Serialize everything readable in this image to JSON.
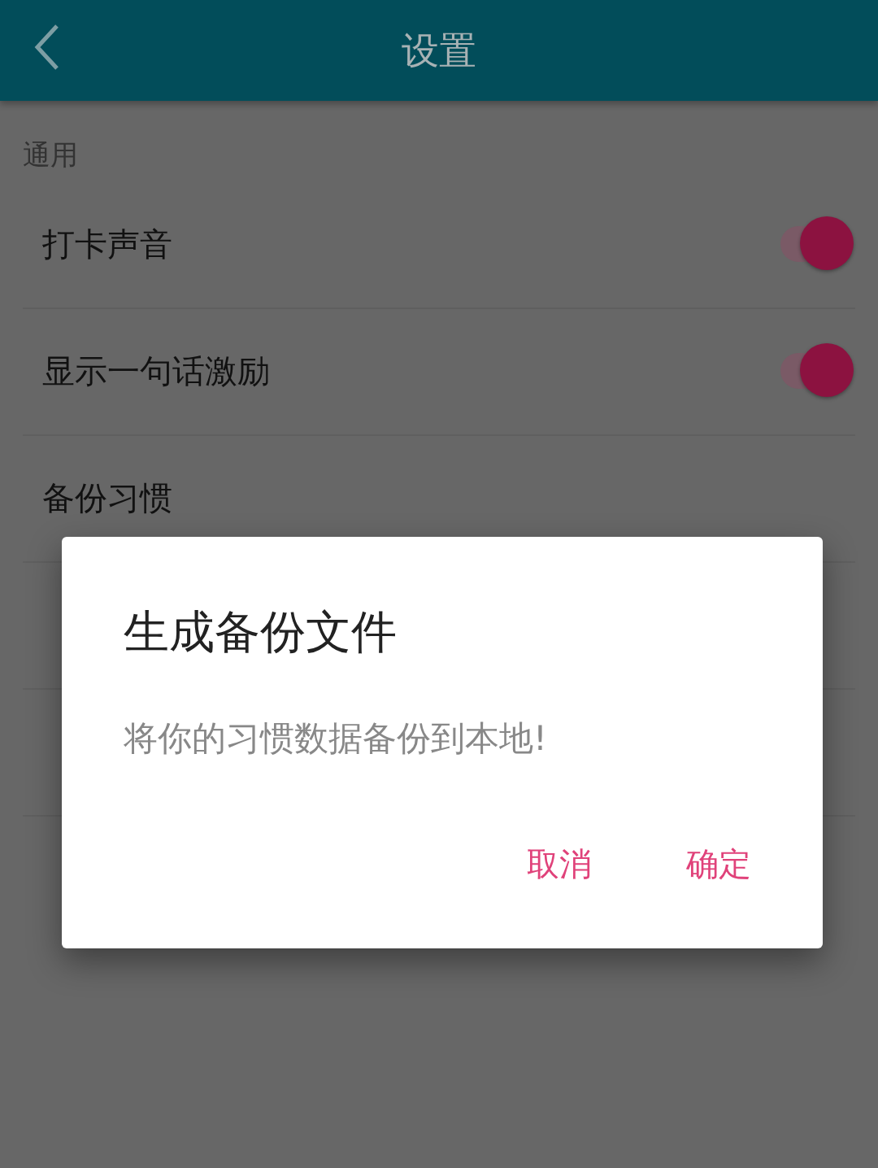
{
  "header": {
    "title": "设置"
  },
  "section": "通用",
  "rows": [
    {
      "kind": "toggle",
      "label": "打卡声音",
      "on": true
    },
    {
      "kind": "toggle",
      "label": "显示一句话激励",
      "on": true
    },
    {
      "kind": "plain",
      "label": "备份习惯"
    }
  ],
  "dialog": {
    "title": "生成备份文件",
    "message": "将你的习惯数据备份到本地!",
    "buttons": [
      "取消",
      "确定"
    ]
  }
}
